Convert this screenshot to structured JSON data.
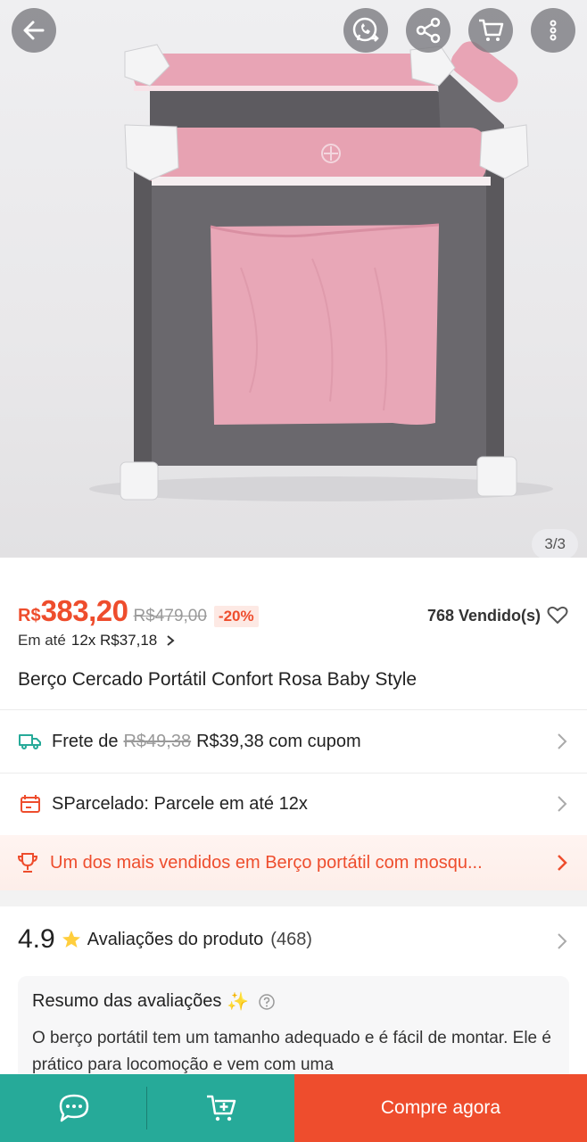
{
  "header": {
    "back_icon": "back-arrow-icon",
    "actions": [
      "whatsapp-icon",
      "share-icon",
      "cart-icon",
      "more-icon"
    ]
  },
  "gallery": {
    "counter": "3/3"
  },
  "product": {
    "currency": "R$",
    "price": "383,20",
    "old_price": "R$479,00",
    "discount": "-20%",
    "sold": "768 Vendido(s)",
    "installment_prefix": "Em até",
    "installment_value": "12x R$37,18",
    "title": "Berço Cercado Portátil Confort Rosa Baby Style"
  },
  "shipping": {
    "label": "Frete de",
    "old": "R$49,38",
    "new": "R$39,38 com cupom"
  },
  "sparcelado": {
    "text": "SParcelado: Parcele em até 12x"
  },
  "bestseller": {
    "text": "Um dos mais vendidos em Berço portátil com mosqu..."
  },
  "reviews": {
    "score": "4.9",
    "label": "Avaliações do produto",
    "count": "(468)",
    "summary_title": "Resumo das avaliações",
    "summary_text": "O berço portátil tem um tamanho adequado e é fácil de montar. Ele é prático para locomoção e vem com uma"
  },
  "bottom_bar": {
    "buy_label": "Compre agora"
  },
  "colors": {
    "accent": "#ee4d2d",
    "teal": "#26aa99",
    "crib_pink": "#e7a2b2",
    "crib_gray": "#666468"
  }
}
